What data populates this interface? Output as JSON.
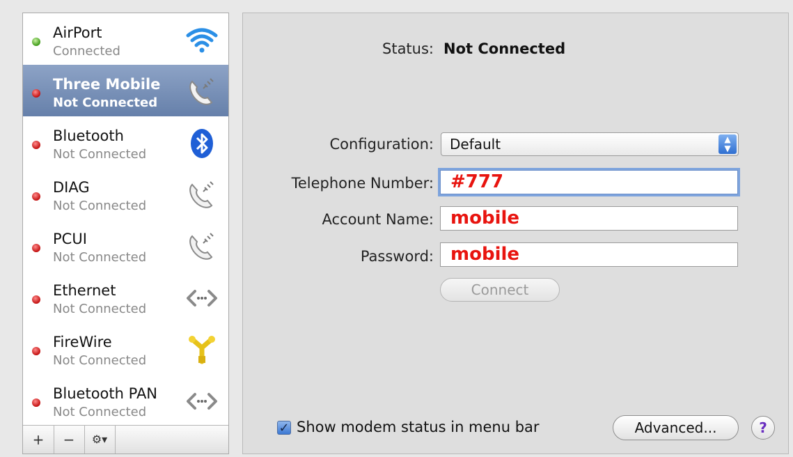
{
  "services": [
    {
      "name": "AirPort",
      "status": "Connected",
      "state": "green",
      "icon": "wifi-icon"
    },
    {
      "name": "Three Mobile",
      "status": "Not Connected",
      "state": "red",
      "icon": "phone-modem-icon",
      "selected": true
    },
    {
      "name": "Bluetooth",
      "status": "Not Connected",
      "state": "red",
      "icon": "bluetooth-icon"
    },
    {
      "name": "DIAG",
      "status": "Not Connected",
      "state": "red",
      "icon": "phone-modem-icon"
    },
    {
      "name": "PCUI",
      "status": "Not Connected",
      "state": "red",
      "icon": "phone-modem-icon"
    },
    {
      "name": "Ethernet",
      "status": "Not Connected",
      "state": "red",
      "icon": "ethernet-icon"
    },
    {
      "name": "FireWire",
      "status": "Not Connected",
      "state": "red",
      "icon": "firewire-icon"
    },
    {
      "name": "Bluetooth PAN",
      "status": "Not Connected",
      "state": "red",
      "icon": "ethernet-icon"
    }
  ],
  "list_toolbar": {
    "add": "+",
    "remove": "−",
    "action": "⚙▾"
  },
  "detail": {
    "status_label": "Status:",
    "status_value": "Not Connected",
    "configuration_label": "Configuration:",
    "configuration_value": "Default",
    "telephone_label": "Telephone Number:",
    "telephone_value": "#777",
    "account_label": "Account Name:",
    "account_value": "mobile",
    "password_label": "Password:",
    "password_value": "mobile",
    "connect_label": "Connect",
    "show_modem_label": "Show modem status in menu bar",
    "show_modem_checked": true,
    "advanced_label": "Advanced...",
    "help_label": "?"
  },
  "colors": {
    "selection": "#6f88b2",
    "field_value": "#e8140f",
    "connected": "#3d9a17",
    "not_connected": "#c21010"
  }
}
